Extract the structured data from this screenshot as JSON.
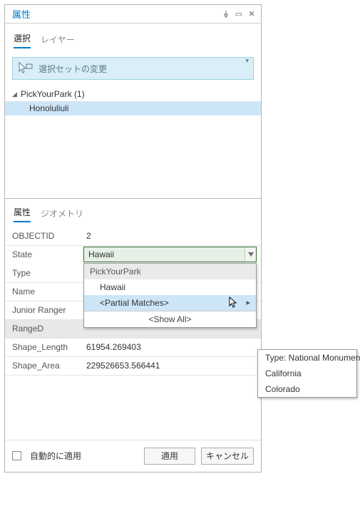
{
  "titlebar": {
    "title": "属性"
  },
  "topTabs": {
    "selection": "選択",
    "layer": "レイヤー"
  },
  "changeSelection": {
    "label": "選択セットの変更"
  },
  "tree": {
    "root": {
      "label": "PickYourPark",
      "count": "(1)"
    },
    "child": "Honoluliuli"
  },
  "lowerTabs": {
    "attributes": "属性",
    "geometry": "ジオメトリ"
  },
  "fields": {
    "objectid": {
      "label": "OBJECTID",
      "value": "2"
    },
    "state": {
      "label": "State",
      "value": "Hawaii"
    },
    "type": {
      "label": "Type",
      "value": ""
    },
    "name": {
      "label": "Name",
      "value": ""
    },
    "junior": {
      "label": "Junior Ranger",
      "value": ""
    },
    "ranged": {
      "label": "RangeD",
      "value": ""
    },
    "shapelen": {
      "label": "Shape_Length",
      "value": "61954.269403"
    },
    "shapearea": {
      "label": "Shape_Area",
      "value": "229526653.566441"
    }
  },
  "dropdown": {
    "group": "PickYourPark",
    "item1": "Hawaii",
    "partial": "<Partial Matches>",
    "showall": "<Show All>"
  },
  "submenu": {
    "line1": "Type: National Monument",
    "line2": "California",
    "line3": "Colorado"
  },
  "footer": {
    "autoApply": "自動的に適用",
    "apply": "適用",
    "cancel": "キャンセル"
  }
}
